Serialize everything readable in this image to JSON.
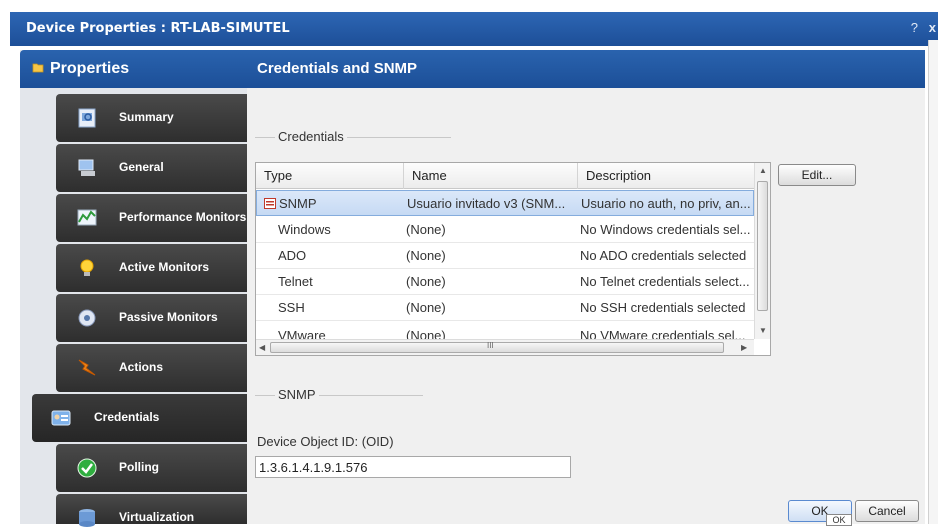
{
  "window": {
    "title": "Device Properties : RT-LAB-SIMUTEL",
    "help": "?",
    "close": "x"
  },
  "left": {
    "header": "Properties",
    "items": [
      {
        "label": "Summary",
        "icon": "summary-icon"
      },
      {
        "label": "General",
        "icon": "computer-icon"
      },
      {
        "label": "Performance Monitors",
        "icon": "chart-icon"
      },
      {
        "label": "Active Monitors",
        "icon": "lightbulb-icon"
      },
      {
        "label": "Passive Monitors",
        "icon": "disc-icon"
      },
      {
        "label": "Actions",
        "icon": "lightning-icon"
      },
      {
        "label": "Credentials",
        "icon": "id-card-icon"
      },
      {
        "label": "Polling",
        "icon": "checkmark-icon"
      },
      {
        "label": "Virtualization",
        "icon": "database-icon"
      }
    ]
  },
  "main": {
    "header": "Credentials and SNMP",
    "credentials_group": "Credentials",
    "edit_button": "Edit...",
    "table": {
      "columns": [
        "Type",
        "Name",
        "Description"
      ],
      "rows": [
        {
          "type": "SNMP",
          "name": "Usuario invitado v3 (SNM...",
          "description": "Usuario no auth, no priv, an..."
        },
        {
          "type": "Windows",
          "name": "(None)",
          "description": "No Windows credentials sel..."
        },
        {
          "type": "ADO",
          "name": "(None)",
          "description": "No ADO credentials selected"
        },
        {
          "type": "Telnet",
          "name": "(None)",
          "description": "No Telnet credentials select..."
        },
        {
          "type": "SSH",
          "name": "(None)",
          "description": "No SSH credentials selected"
        },
        {
          "type": "VMware",
          "name": "(None)",
          "description": "No VMware credentials sel..."
        }
      ],
      "hscroll_grip": "III"
    },
    "snmp_group": "SNMP",
    "oid_label": "Device Object ID: (OID)",
    "oid_value": "1.3.6.1.4.1.9.1.576",
    "ok_button": "OK",
    "cancel_button": "Cancel",
    "ok_tooltip": "OK"
  },
  "colors": {
    "titlebar": "#1d4f98",
    "active_accent": "#f0a020",
    "nav_bg": "#2e2e2e"
  }
}
